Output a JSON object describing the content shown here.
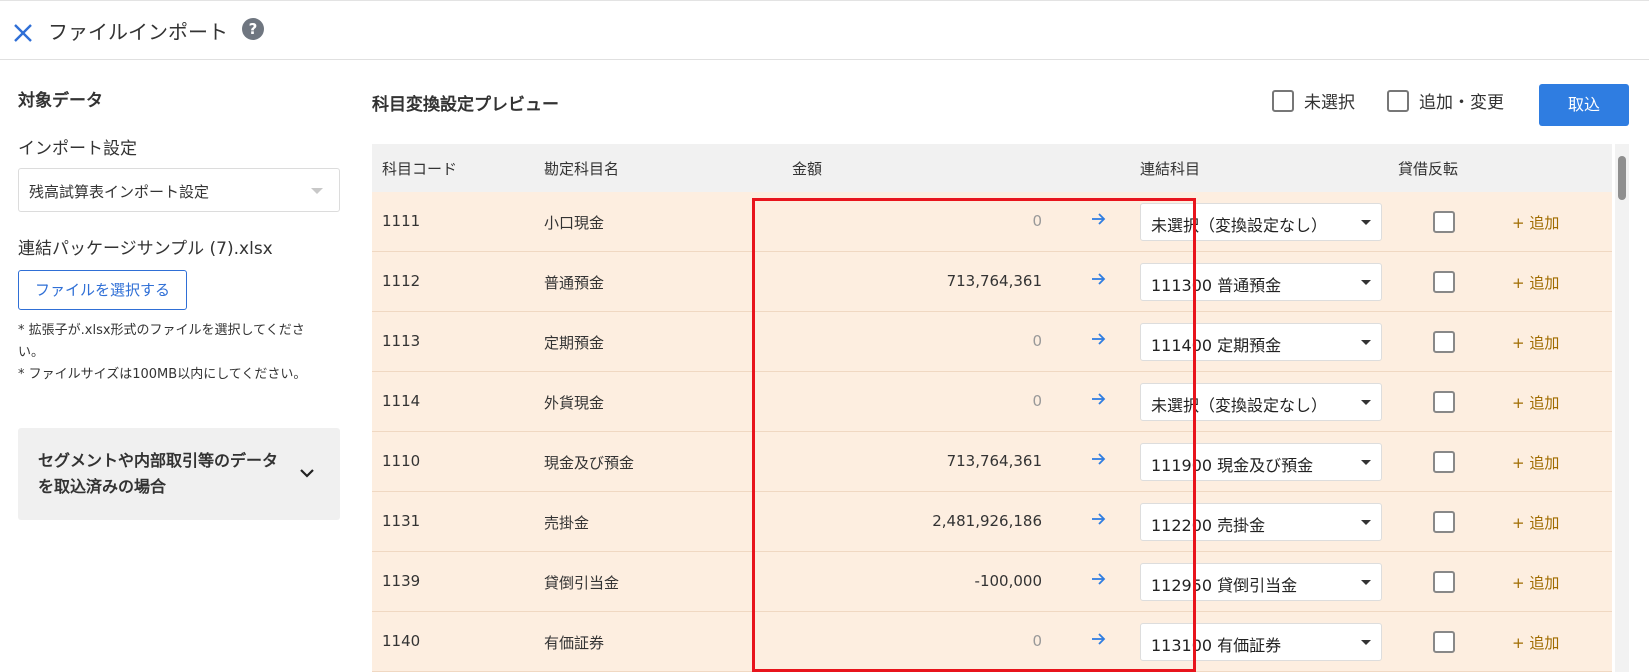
{
  "header": {
    "title": "ファイルインポート",
    "help_glyph": "?"
  },
  "left": {
    "target_title": "対象データ",
    "import_setting_label": "インポート設定",
    "import_setting_value": "残高試算表インポート設定",
    "file_name": "連結パッケージサンプル (7).xlsx",
    "file_button": "ファイルを選択する",
    "note1": "* 拡張子が.xlsx形式のファイルを選択してください。",
    "note2": "* ファイルサイズは100MB以内にしてください。",
    "segment_text": "セグメントや内部取引等のデータを取込済みの場合"
  },
  "main": {
    "preview_title": "科目変換設定プレビュー",
    "legend_unselected": "未選択",
    "legend_add_change": "追加・変更",
    "import_button": "取込",
    "columns": {
      "code": "科目コード",
      "name": "勘定科目名",
      "amount": "金額",
      "consolidated": "連結科目",
      "reverse": "貸借反転"
    },
    "add_label": "+ 追加",
    "rows": [
      {
        "code": "1111",
        "name": "小口現金",
        "amount": "0",
        "consolidated": "未選択（変換設定なし）"
      },
      {
        "code": "1112",
        "name": "普通預金",
        "amount": "713,764,361",
        "consolidated": "111300 普通預金"
      },
      {
        "code": "1113",
        "name": "定期預金",
        "amount": "0",
        "consolidated": "111400 定期預金"
      },
      {
        "code": "1114",
        "name": "外貨現金",
        "amount": "0",
        "consolidated": "未選択（変換設定なし）"
      },
      {
        "code": "1110",
        "name": "現金及び預金",
        "amount": "713,764,361",
        "consolidated": "111900 現金及び預金"
      },
      {
        "code": "1131",
        "name": "売掛金",
        "amount": "2,481,926,186",
        "consolidated": "112200 売掛金"
      },
      {
        "code": "1139",
        "name": "貸倒引当金",
        "amount": "-100,000",
        "consolidated": "112950 貸倒引当金"
      },
      {
        "code": "1140",
        "name": "有価証券",
        "amount": "0",
        "consolidated": "113100 有価証券"
      }
    ]
  },
  "colors": {
    "accent": "#2f7de1",
    "row_bg": "#fdeee0",
    "highlight": "#e8141c",
    "add_link": "#a06c00"
  }
}
